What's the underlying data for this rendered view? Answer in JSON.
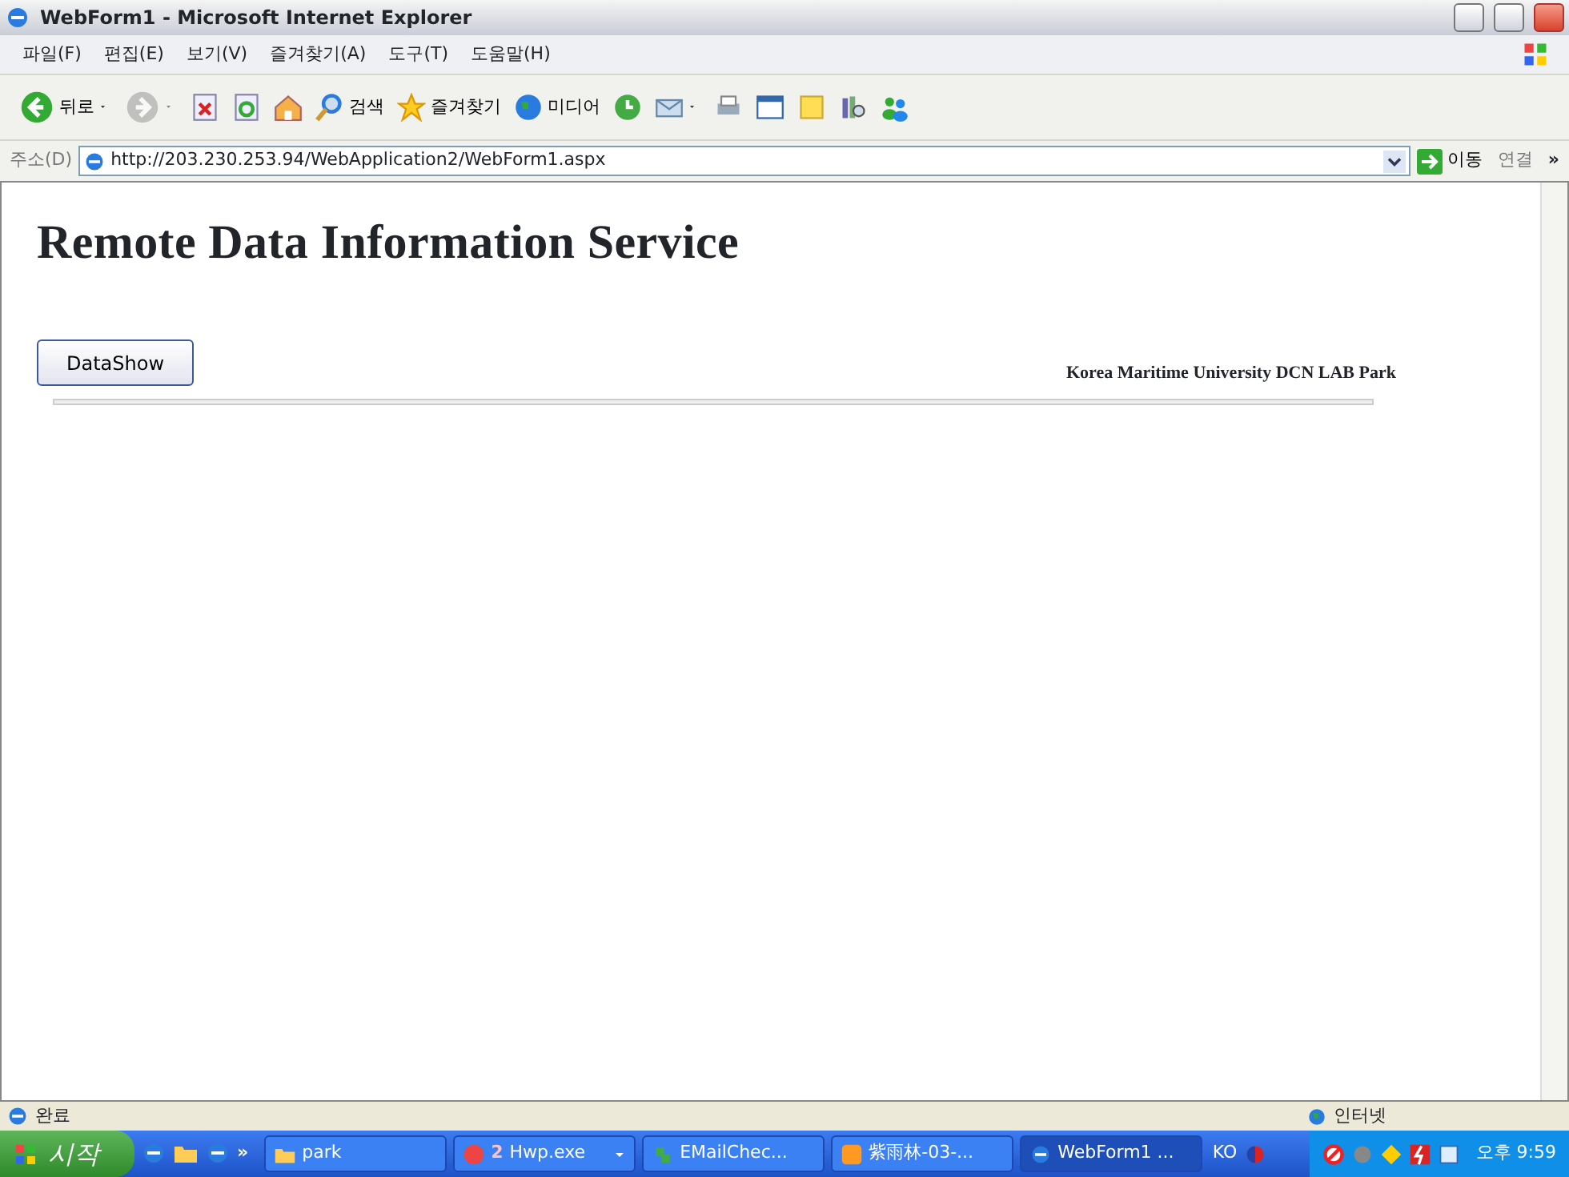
{
  "window": {
    "title": "WebForm1 - Microsoft Internet Explorer"
  },
  "menu": [
    "파일(F)",
    "편집(E)",
    "보기(V)",
    "즐겨찾기(A)",
    "도구(T)",
    "도움말(H)"
  ],
  "toolbar": [
    {
      "label": "뒤로",
      "dropdown": true,
      "disabled": false
    },
    {
      "dropdown": true,
      "disabled": true
    },
    {
      "dropdown": false,
      "disabled": false
    },
    {
      "dropdown": false,
      "disabled": false
    },
    {
      "dropdown": false,
      "disabled": false
    },
    {
      "label": "검색",
      "dropdown": false,
      "disabled": false
    },
    {
      "label": "즐겨찾기",
      "dropdown": false,
      "disabled": false
    },
    {
      "label": "미디어",
      "dropdown": false,
      "disabled": false
    },
    {
      "dropdown": false,
      "disabled": false
    },
    {
      "dropdown": true,
      "disabled": false
    },
    {
      "dropdown": false,
      "disabled": false
    },
    {
      "dropdown": false,
      "disabled": false
    },
    {
      "dropdown": false,
      "disabled": false
    },
    {
      "dropdown": false,
      "disabled": false
    },
    {
      "dropdown": false,
      "disabled": false
    }
  ],
  "address": {
    "label": "주소(D)",
    "url": "http://203.230.253.94/WebApplication2/WebForm1.aspx",
    "go": "이동",
    "links": "연결",
    "more": "»"
  },
  "page": {
    "heading": "Remote Data Information Service",
    "button": "DataShow",
    "credit": "Korea Maritime University DCN LAB  Park"
  },
  "status_bar": {
    "text": "완료",
    "zone": "인터넷"
  },
  "taskbar": {
    "start": "시작",
    "quick_more": "»",
    "tasks": [
      {
        "label": "park",
        "selected": false
      },
      {
        "count": "2",
        "label": "Hwp.exe",
        "selected": false,
        "dropdown": true
      },
      {
        "label": "EMailChec...",
        "selected": false
      },
      {
        "label": "紫雨林-03-...",
        "selected": false
      },
      {
        "label": "WebForm1 ...",
        "selected": true
      }
    ],
    "language": "KO",
    "clock": "오후 9:59"
  }
}
